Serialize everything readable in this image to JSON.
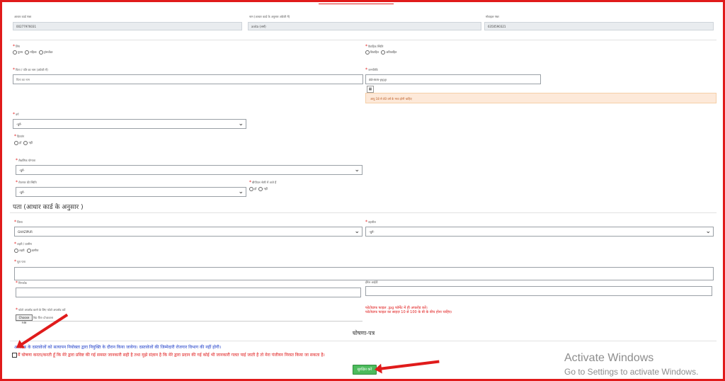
{
  "top_fields": {
    "aadhaar": {
      "label": "आधार कार्ड नंबर",
      "value": "00277976031"
    },
    "name": {
      "label": "नाम (आधार कार्ड के अनुसार अंग्रेजी में)",
      "value": "anita (शर्मा)"
    },
    "mobile": {
      "label": "मोबाइल नंबर",
      "value": "6350590321"
    }
  },
  "gender": {
    "label": "लिंग",
    "options": [
      "पुरुष",
      "महिला",
      "ट्रांसजेंडर"
    ]
  },
  "marital": {
    "label": "वैवाहिक स्थिति",
    "options": [
      "विवाहित",
      "अविवाहित"
    ]
  },
  "father_name": {
    "label": "पिता / पति का नाम (अंग्रेजी में)",
    "placeholder": "पिता का नाम"
  },
  "dob": {
    "label": "जन्मतिथि",
    "value": "dd-mm-yyyy",
    "calendar_icon": "▦",
    "warning": "आयु 18 से 40 वर्ष के मध्य होनी चाहिए"
  },
  "category": {
    "label": "वर्ग",
    "value": "-चुनें-"
  },
  "disability": {
    "label": "दिव्यांग",
    "options": [
      "हाँ",
      "नहीं"
    ]
  },
  "education": {
    "label": "शैक्षणिक योग्यता",
    "value": "-चुनें-"
  },
  "employment": {
    "label": "रोजगार की स्थिति",
    "value": "-चुनें-"
  },
  "bpl": {
    "label": "बीपीएल श्रेणी में आते हैं",
    "options": [
      "हाँ",
      "नहीं"
    ]
  },
  "address_title": "पता (आधार कार्ड के अनुसार )",
  "district": {
    "label": "जिला",
    "value": "GHAZIPUR"
  },
  "tehsil": {
    "label": "तहसील",
    "value": "-चुनें-"
  },
  "area": {
    "label": "शहरी / ग्रामीण",
    "options": [
      "शहरी",
      "ग्रामीण"
    ]
  },
  "full_address": {
    "label": "पूरा पता"
  },
  "pincode": {
    "label": "पिनकोड"
  },
  "email": {
    "label": "ईमेल आईडी"
  },
  "photo": {
    "label": "फोटो अपलोड करने के लिए फोटो अपलोड करें",
    "button": "Choose File",
    "status": "No file chosen"
  },
  "photo_note": {
    "line1": "फोटोग्राफ फाइल .jpg फॉर्मेट में ही अपलोड करें।",
    "line2": "फोटोग्राफ फाइल का साइज़ 10 से 100 के बी के बीच होना चाहिए।"
  },
  "declaration": {
    "title": "घोषणा-पत्र",
    "note": "आवेदक के दस्तावेजों को सत्यापन नियोक्ता द्वारा नियुक्ति के दौरान किया जायेगा। दस्तावेजों की जिम्मेदारी रोजगार विभाग की नहीं होगी।",
    "checkbox_text": "मैं घोषणा करता/करती हूँ कि मेरे द्वारा प्रविष्ट की गई समस्त जानकारी सही है तथा मुझे संज्ञान है कि मेरे द्वारा प्रदान की गई कोई भी जानकारी गलत पाई जाती है तो मेरा पंजीयन निरस्त किया जा सकता है।"
  },
  "submit_label": "सुरक्षित करें",
  "watermark": {
    "title": "Activate Windows",
    "subtitle": "Go to Settings to activate Windows."
  }
}
